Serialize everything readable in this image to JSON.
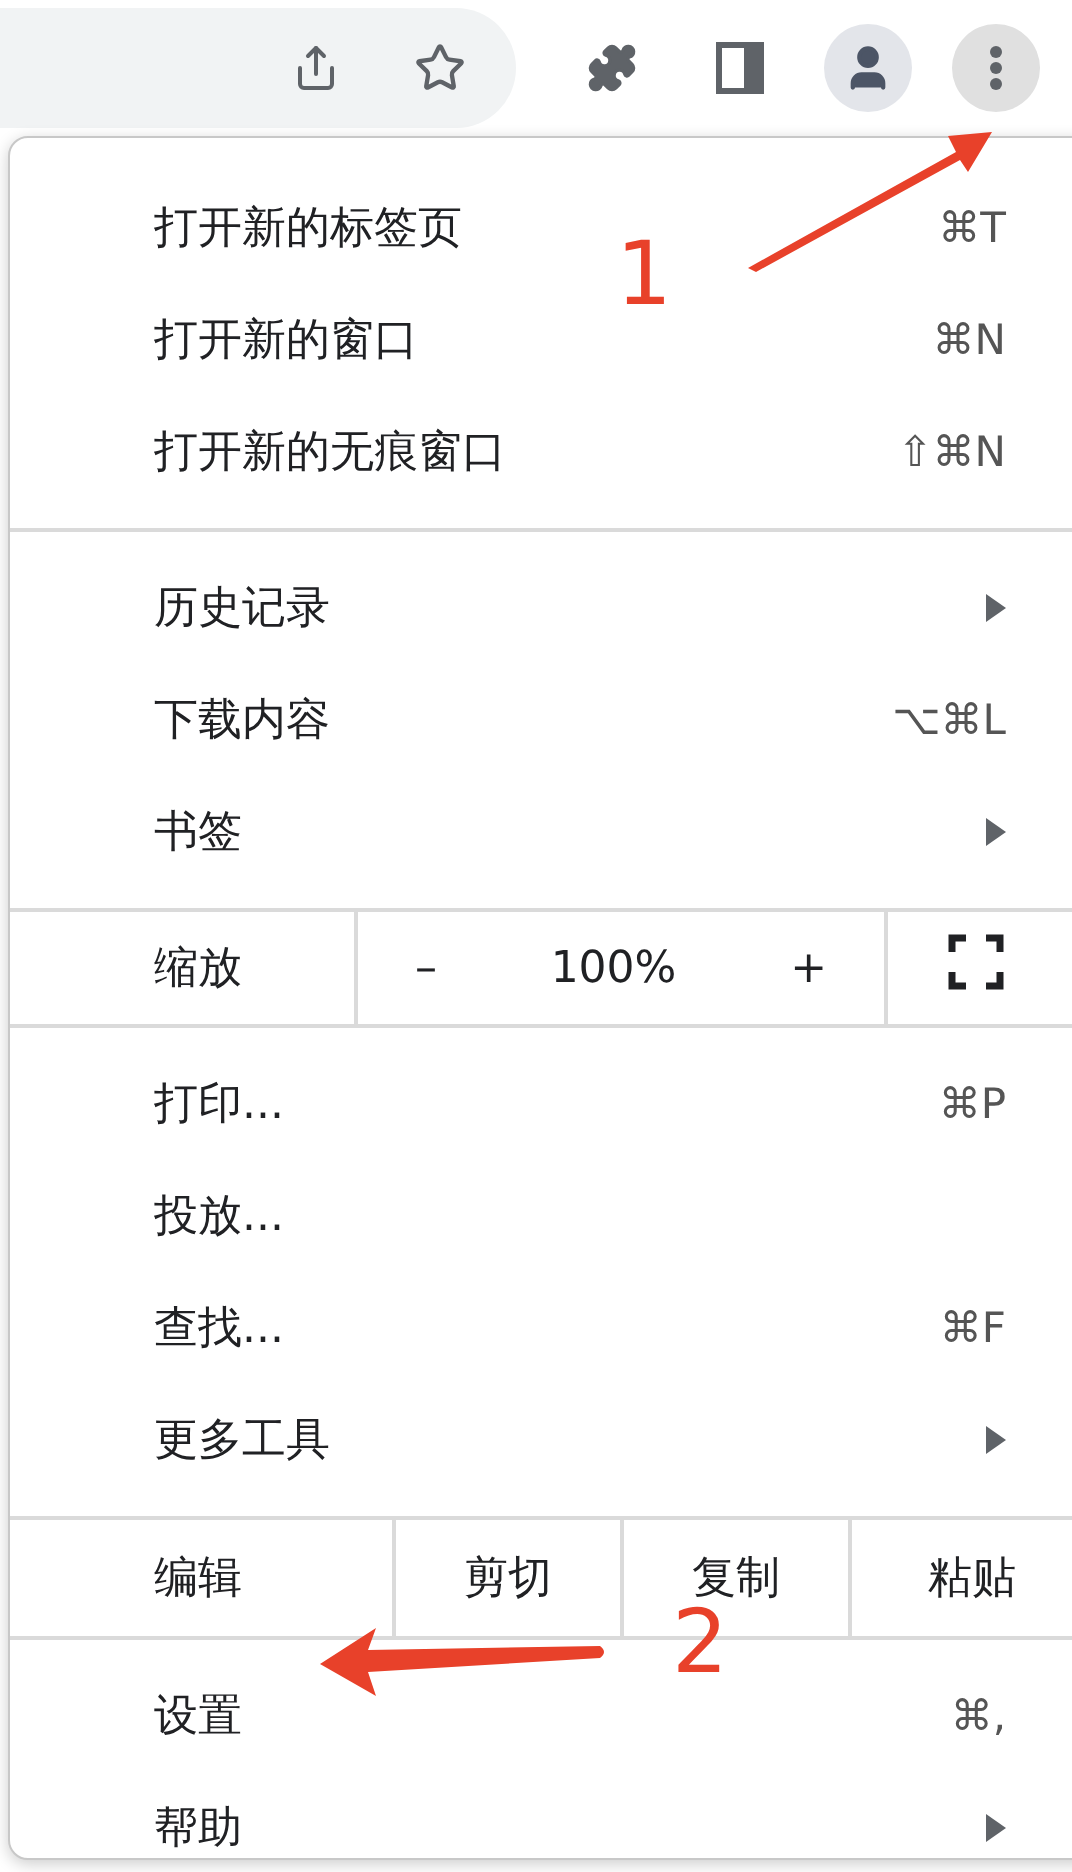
{
  "toolbar": {
    "buttons": [
      {
        "kind": "share"
      },
      {
        "kind": "star"
      },
      {
        "kind": "extensions"
      },
      {
        "kind": "side-panel"
      },
      {
        "kind": "profile"
      },
      {
        "kind": "menu",
        "selected": true
      }
    ]
  },
  "menu": {
    "sections": [
      {
        "kind": "items",
        "items": [
          {
            "label": "打开新的标签页",
            "shortcut": "⌘T",
            "submenu": false
          },
          {
            "label": "打开新的窗口",
            "shortcut": "⌘N",
            "submenu": false
          },
          {
            "label": "打开新的无痕窗口",
            "shortcut": "⇧⌘N",
            "submenu": false
          }
        ]
      },
      {
        "kind": "items",
        "items": [
          {
            "label": "历史记录",
            "submenu": true
          },
          {
            "label": "下载内容",
            "shortcut": "⌥⌘L",
            "submenu": false
          },
          {
            "label": "书签",
            "submenu": true
          }
        ]
      },
      {
        "kind": "zoom",
        "label": "缩放",
        "minus": "–",
        "value": "100%",
        "plus": "+"
      },
      {
        "kind": "items",
        "items": [
          {
            "label": "打印...",
            "shortcut": "⌘P",
            "submenu": false
          },
          {
            "label": "投放...",
            "submenu": false
          },
          {
            "label": "查找...",
            "shortcut": "⌘F",
            "submenu": false
          },
          {
            "label": "更多工具",
            "submenu": true
          }
        ]
      },
      {
        "kind": "edit",
        "label": "编辑",
        "buttons": [
          "剪切",
          "复制",
          "粘贴"
        ]
      },
      {
        "kind": "items",
        "items": [
          {
            "label": "设置",
            "shortcut": "⌘,",
            "submenu": false
          },
          {
            "label": "帮助",
            "submenu": true
          }
        ]
      }
    ]
  },
  "annotations": [
    {
      "label": "1"
    },
    {
      "label": "2"
    }
  ]
}
